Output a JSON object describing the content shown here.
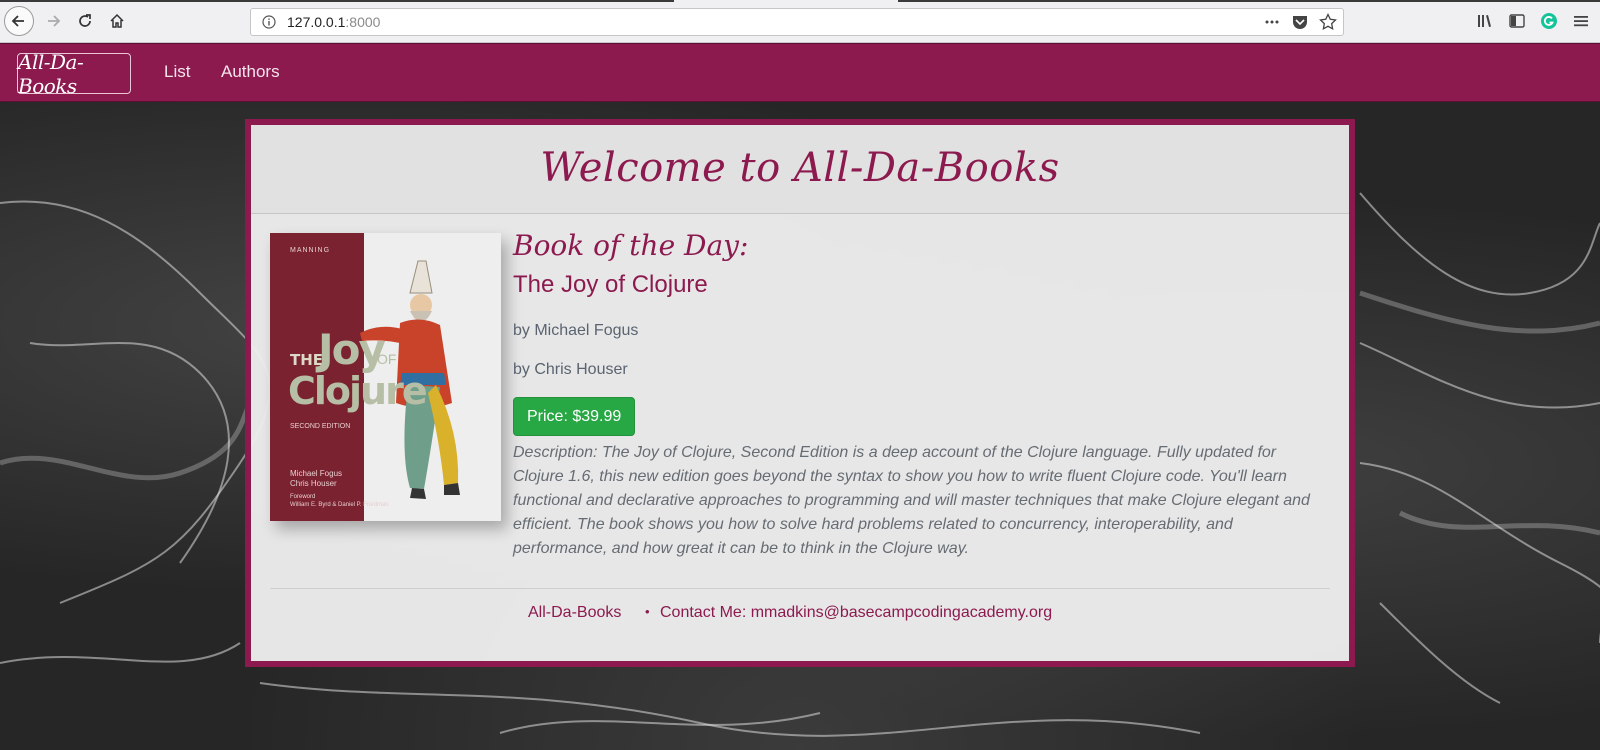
{
  "browser": {
    "url_host": "127.0.0.1",
    "url_port": ":8000"
  },
  "nav": {
    "brand": "All-Da-Books",
    "links": [
      "List",
      "Authors"
    ]
  },
  "page": {
    "welcome_title": "Welcome to All-Da-Books",
    "botd_label": "Book of the Day:",
    "book_title": "The Joy of Clojure",
    "authors": [
      "by Michael Fogus",
      "by Chris Houser"
    ],
    "price_label": "Price: $39.99",
    "description": "Description: The Joy of Clojure, Second Edition is a deep account of the Clojure language. Fully updated for Clojure 1.6, this new edition goes beyond the syntax to show you how to write fluent Clojure code. You'll learn functional and declarative approaches to programming and will master techniques that make Clojure elegant and efficient. The book shows you how to solve hard problems related to concurrency, interoperability, and performance, and how great it can be to think in the Clojure way."
  },
  "cover": {
    "publisher": "MANNING",
    "title_the": "THE",
    "title_joy": "Joy",
    "title_of": "OF",
    "title_clojure": "Clojure",
    "edition": "SECOND EDITION",
    "author_1": "Michael Fogus",
    "author_2": "Chris Houser",
    "foreword_label": "Foreword",
    "foreword_names": "William E. Byrd & Daniel P. Friedman"
  },
  "footer": {
    "brand": "All-Da-Books",
    "bullet": "•",
    "contact": "Contact Me: mmadkins@basecampcodingacademy.org"
  },
  "colors": {
    "brand": "#8c1a4f",
    "price_button": "#28a745",
    "background": "#262626"
  },
  "icons": [
    "back-icon",
    "forward-icon",
    "reload-icon",
    "home-icon",
    "info-icon",
    "more-icon",
    "pocket-icon",
    "star-icon",
    "library-icon",
    "sidebar-icon",
    "grammarly-icon",
    "menu-icon"
  ]
}
